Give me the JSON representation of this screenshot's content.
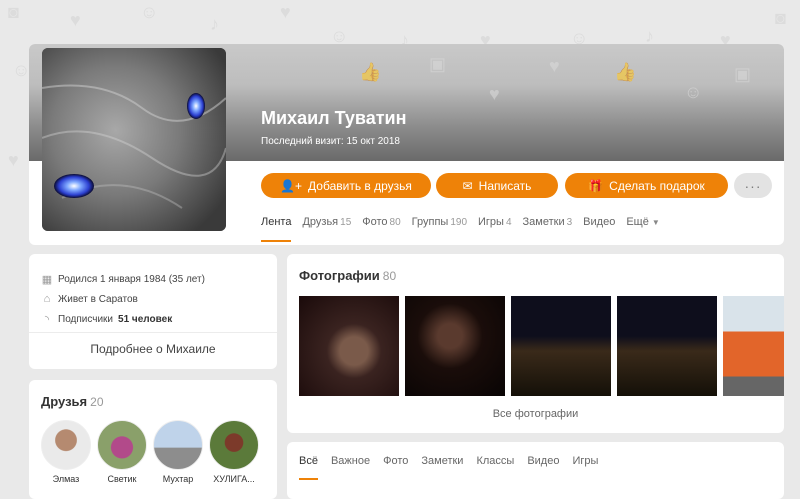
{
  "profile": {
    "name": "Михаил Туватин",
    "last_visit": "Последний визит: 15 окт 2018",
    "actions": {
      "add_friend": "Добавить в друзья",
      "write": "Написать",
      "gift": "Сделать подарок",
      "more": "···"
    },
    "tabs": [
      {
        "label": "Лента",
        "count": ""
      },
      {
        "label": "Друзья",
        "count": "15"
      },
      {
        "label": "Фото",
        "count": "80"
      },
      {
        "label": "Группы",
        "count": "190"
      },
      {
        "label": "Игры",
        "count": "4"
      },
      {
        "label": "Заметки",
        "count": "3"
      },
      {
        "label": "Видео",
        "count": ""
      },
      {
        "label": "Ещё",
        "count": ""
      }
    ]
  },
  "about": {
    "born": "Родился 1 января 1984 (35 лет)",
    "lives": "Живет в Саратов",
    "followers_label": "Подписчики",
    "followers_value": "51 человек",
    "more_link": "Подробнее о Михаиле"
  },
  "friends": {
    "title": "Друзья",
    "count": "20",
    "items": [
      {
        "name": "Элмаз"
      },
      {
        "name": "Светик"
      },
      {
        "name": "Мухтар"
      },
      {
        "name": "ХУЛИГА..."
      }
    ]
  },
  "photos": {
    "title": "Фотографии",
    "count": "80",
    "all_link": "Все фотографии"
  },
  "feed": {
    "tabs": [
      "Всё",
      "Важное",
      "Фото",
      "Заметки",
      "Классы",
      "Видео",
      "Игры"
    ]
  },
  "colors": {
    "accent": "#ee8208",
    "background": "#e9e9e9"
  },
  "icons": {
    "add_friend": "user-plus-icon",
    "write": "envelope-icon",
    "gift": "gift-icon",
    "born": "calendar-icon",
    "lives": "home-icon",
    "followers": "rss-icon"
  }
}
